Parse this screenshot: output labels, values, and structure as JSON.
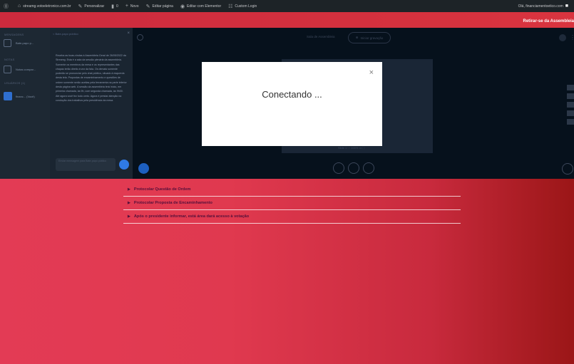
{
  "adminbar": {
    "site": "streamg.votoeletronico.com.br",
    "customize": "Personalizar",
    "comments": "0",
    "new": "Novo",
    "edit": "Editar página",
    "elementor": "Editar com Elementor",
    "custom_login": "Custom Login",
    "greeting": "Olá, financiamentoetico.com"
  },
  "leave_label": "Retirar-se da Assembleia",
  "conference": {
    "sidebar": {
      "messages_head": "MENSAGENS",
      "public_chat": "Bate-papo p...",
      "notes_head": "NOTAS",
      "shared_notes": "Notas compar...",
      "users_head": "USUÁRIOS (1)",
      "user_name": "financ... (Você)"
    },
    "chat": {
      "title": "< Bate-papo público",
      "close": "×",
      "welcome": "Receba as boas-vindas à Assembleia Geral de 26/05/2022 da Streamg. Esta é a sala da sessão plenária da assembleia. Somente os membros da mesa e os representantes das chapas terão direito à vez da fala. Os demais somente poderão se pronunciar pelo chat público, situado à esquerda desta tela. Propostas de encaminhamento e questões de ordem somente serão aceitas pela ferramenta na parte inferior desta página web. A sessão da assembleia terá início, em primeira chamada, às 9h, com segunda chamada, às 9h30. Até agora você fez tudo certo. Agora é prestar atenção na condução dos trabalhos pela presidência da mesa.",
      "input_placeholder": "Enviar mensagem para Bate-papo público"
    },
    "room_label": "Sala de Assembleia",
    "record_label": "Iniciar gravação",
    "slide_controls": "Slide 1  ‹  ›   100%   ▭   ⛶"
  },
  "modal": {
    "text": "Conectando ...",
    "close": "×"
  },
  "accordion": [
    {
      "label": "Protocolar Questão de Ordem"
    },
    {
      "label": "Protocolar Proposta de Encaminhamento"
    },
    {
      "label": "Após o presidente informar, está área dará acesso à votação"
    }
  ],
  "colors": {
    "brand_red": "#e0394f",
    "dark_bg": "#06111c",
    "accordion_text": "#53103a"
  }
}
